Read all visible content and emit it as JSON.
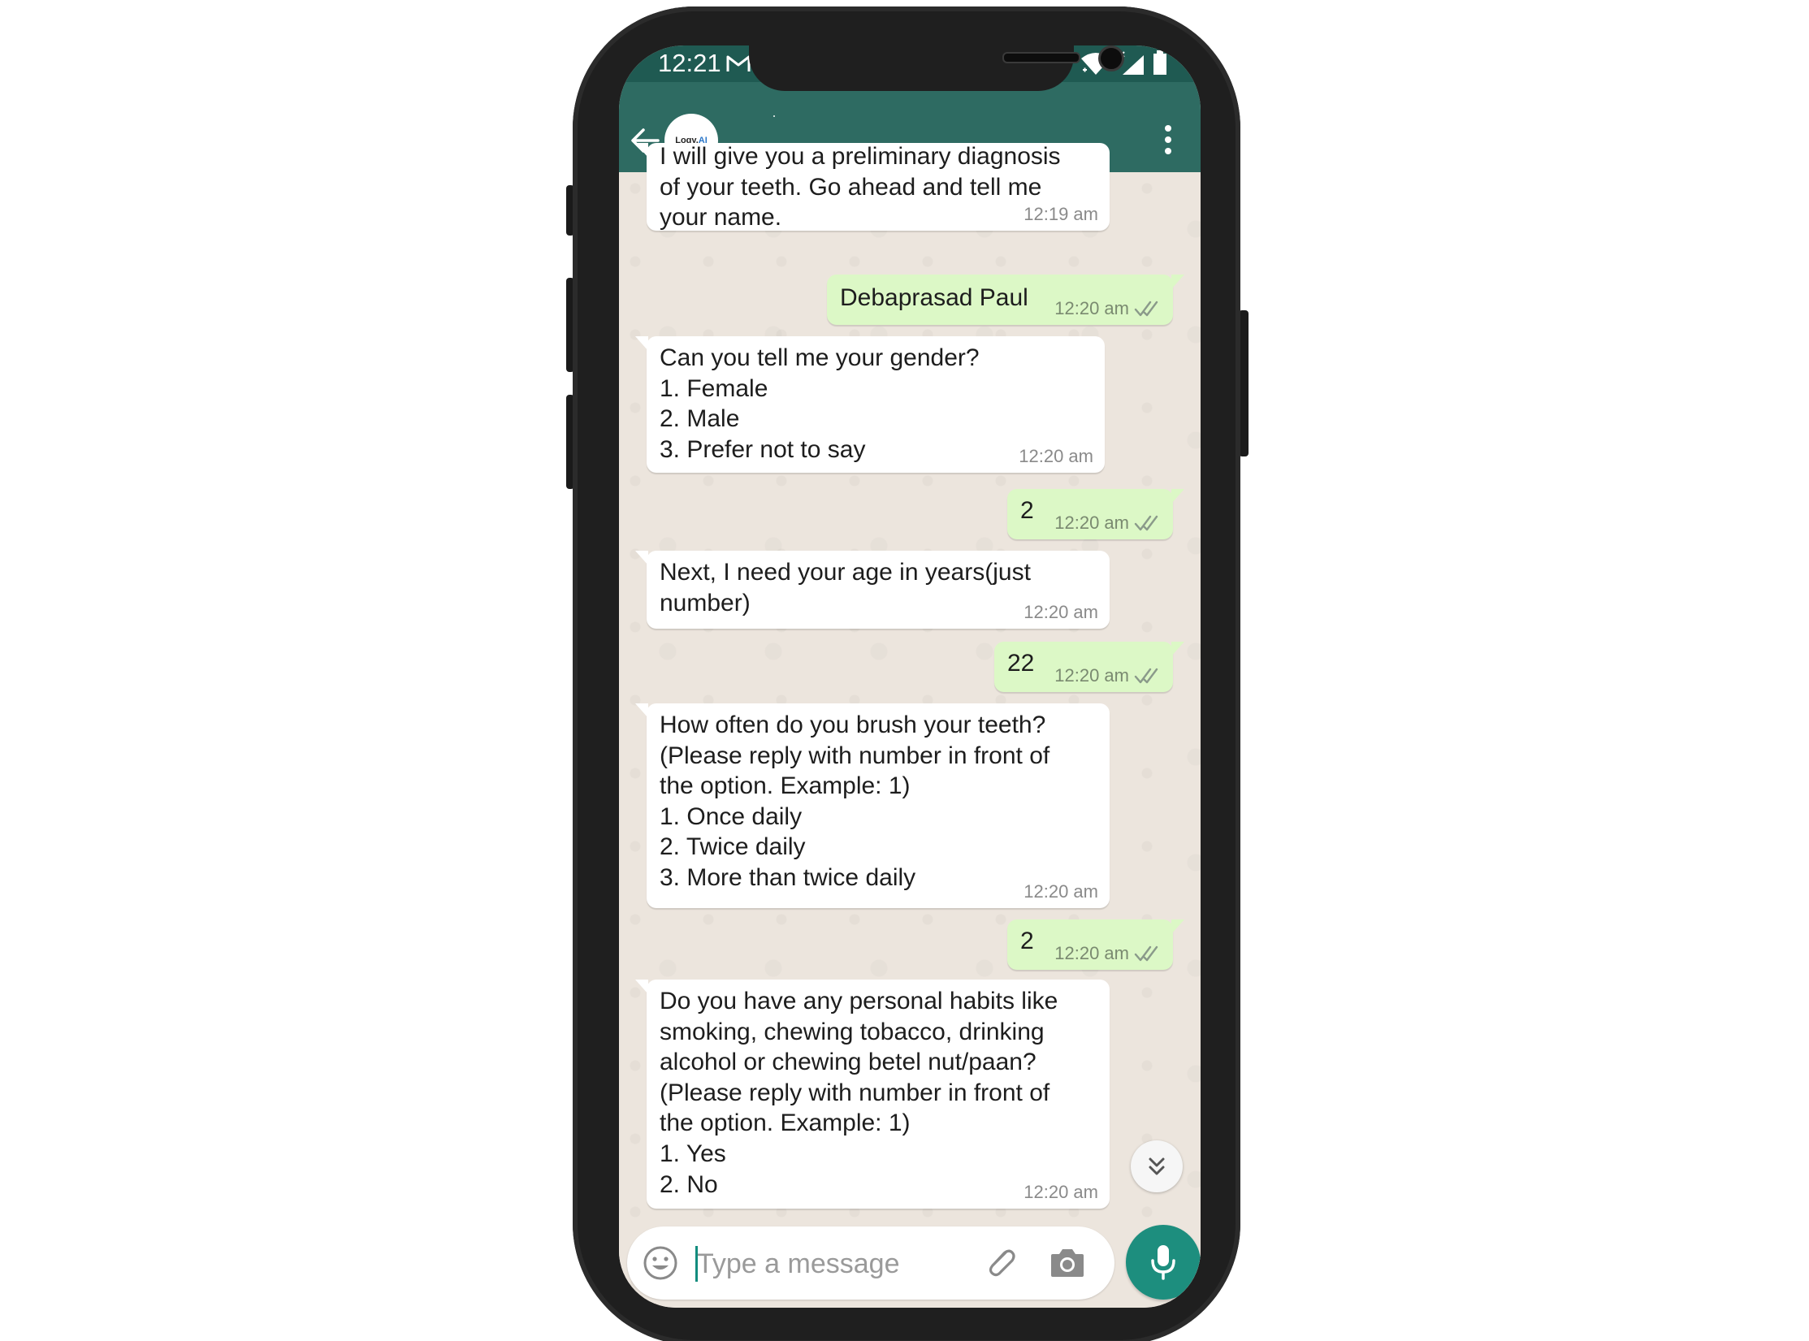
{
  "status_bar": {
    "time": "12:21",
    "icons": [
      "gmail-icon",
      "wifi-icon",
      "signal-icon",
      "battery-icon"
    ]
  },
  "app_bar": {
    "avatar_text": "Logy.",
    "avatar_text_accent": "AI",
    "icons": [
      "back-arrow-icon",
      "more-vertical-icon"
    ]
  },
  "messages": [
    {
      "direction": "in",
      "text": "I will give you a preliminary diagnosis\nof your teeth. Go ahead and tell me\nyour name.",
      "time": "12:19 am"
    },
    {
      "direction": "out",
      "text": "Debaprasad Paul",
      "time": "12:20 am",
      "status": "read-ticks"
    },
    {
      "direction": "in",
      "text": "Can you tell me your gender?\n1. Female\n2. Male\n3. Prefer not to say",
      "time": "12:20 am"
    },
    {
      "direction": "out",
      "text": "2",
      "time": "12:20 am",
      "status": "read-ticks"
    },
    {
      "direction": "in",
      "text": "Next, I need your age in years(just\nnumber)",
      "time": "12:20 am"
    },
    {
      "direction": "out",
      "text": "22",
      "time": "12:20 am",
      "status": "read-ticks"
    },
    {
      "direction": "in",
      "text": "How often do you brush your teeth?\n(Please reply with number in front of\nthe option. Example: 1)\n1. Once daily\n2. Twice daily\n3. More than twice daily",
      "time": "12:20 am"
    },
    {
      "direction": "out",
      "text": "2",
      "time": "12:20 am",
      "status": "read-ticks"
    },
    {
      "direction": "in",
      "text": "Do you have any personal habits like\nsmoking, chewing tobacco, drinking\nalcohol or chewing betel nut/paan?\n(Please reply with number in front of\nthe option. Example: 1)\n1. Yes\n2. No",
      "time": "12:20 am"
    }
  ],
  "composer": {
    "placeholder": "Type a message",
    "value": "",
    "icons": [
      "emoji-icon",
      "paperclip-icon",
      "camera-icon",
      "microphone-icon"
    ]
  },
  "colors": {
    "header": "#2e6b62",
    "status_bar": "#1f5a52",
    "outgoing_bubble": "#dcf8c6",
    "incoming_bubble": "#ffffff",
    "chat_background": "#ece5dd",
    "accent": "#1d8e7e",
    "read_tick": "#8a9a8a"
  }
}
